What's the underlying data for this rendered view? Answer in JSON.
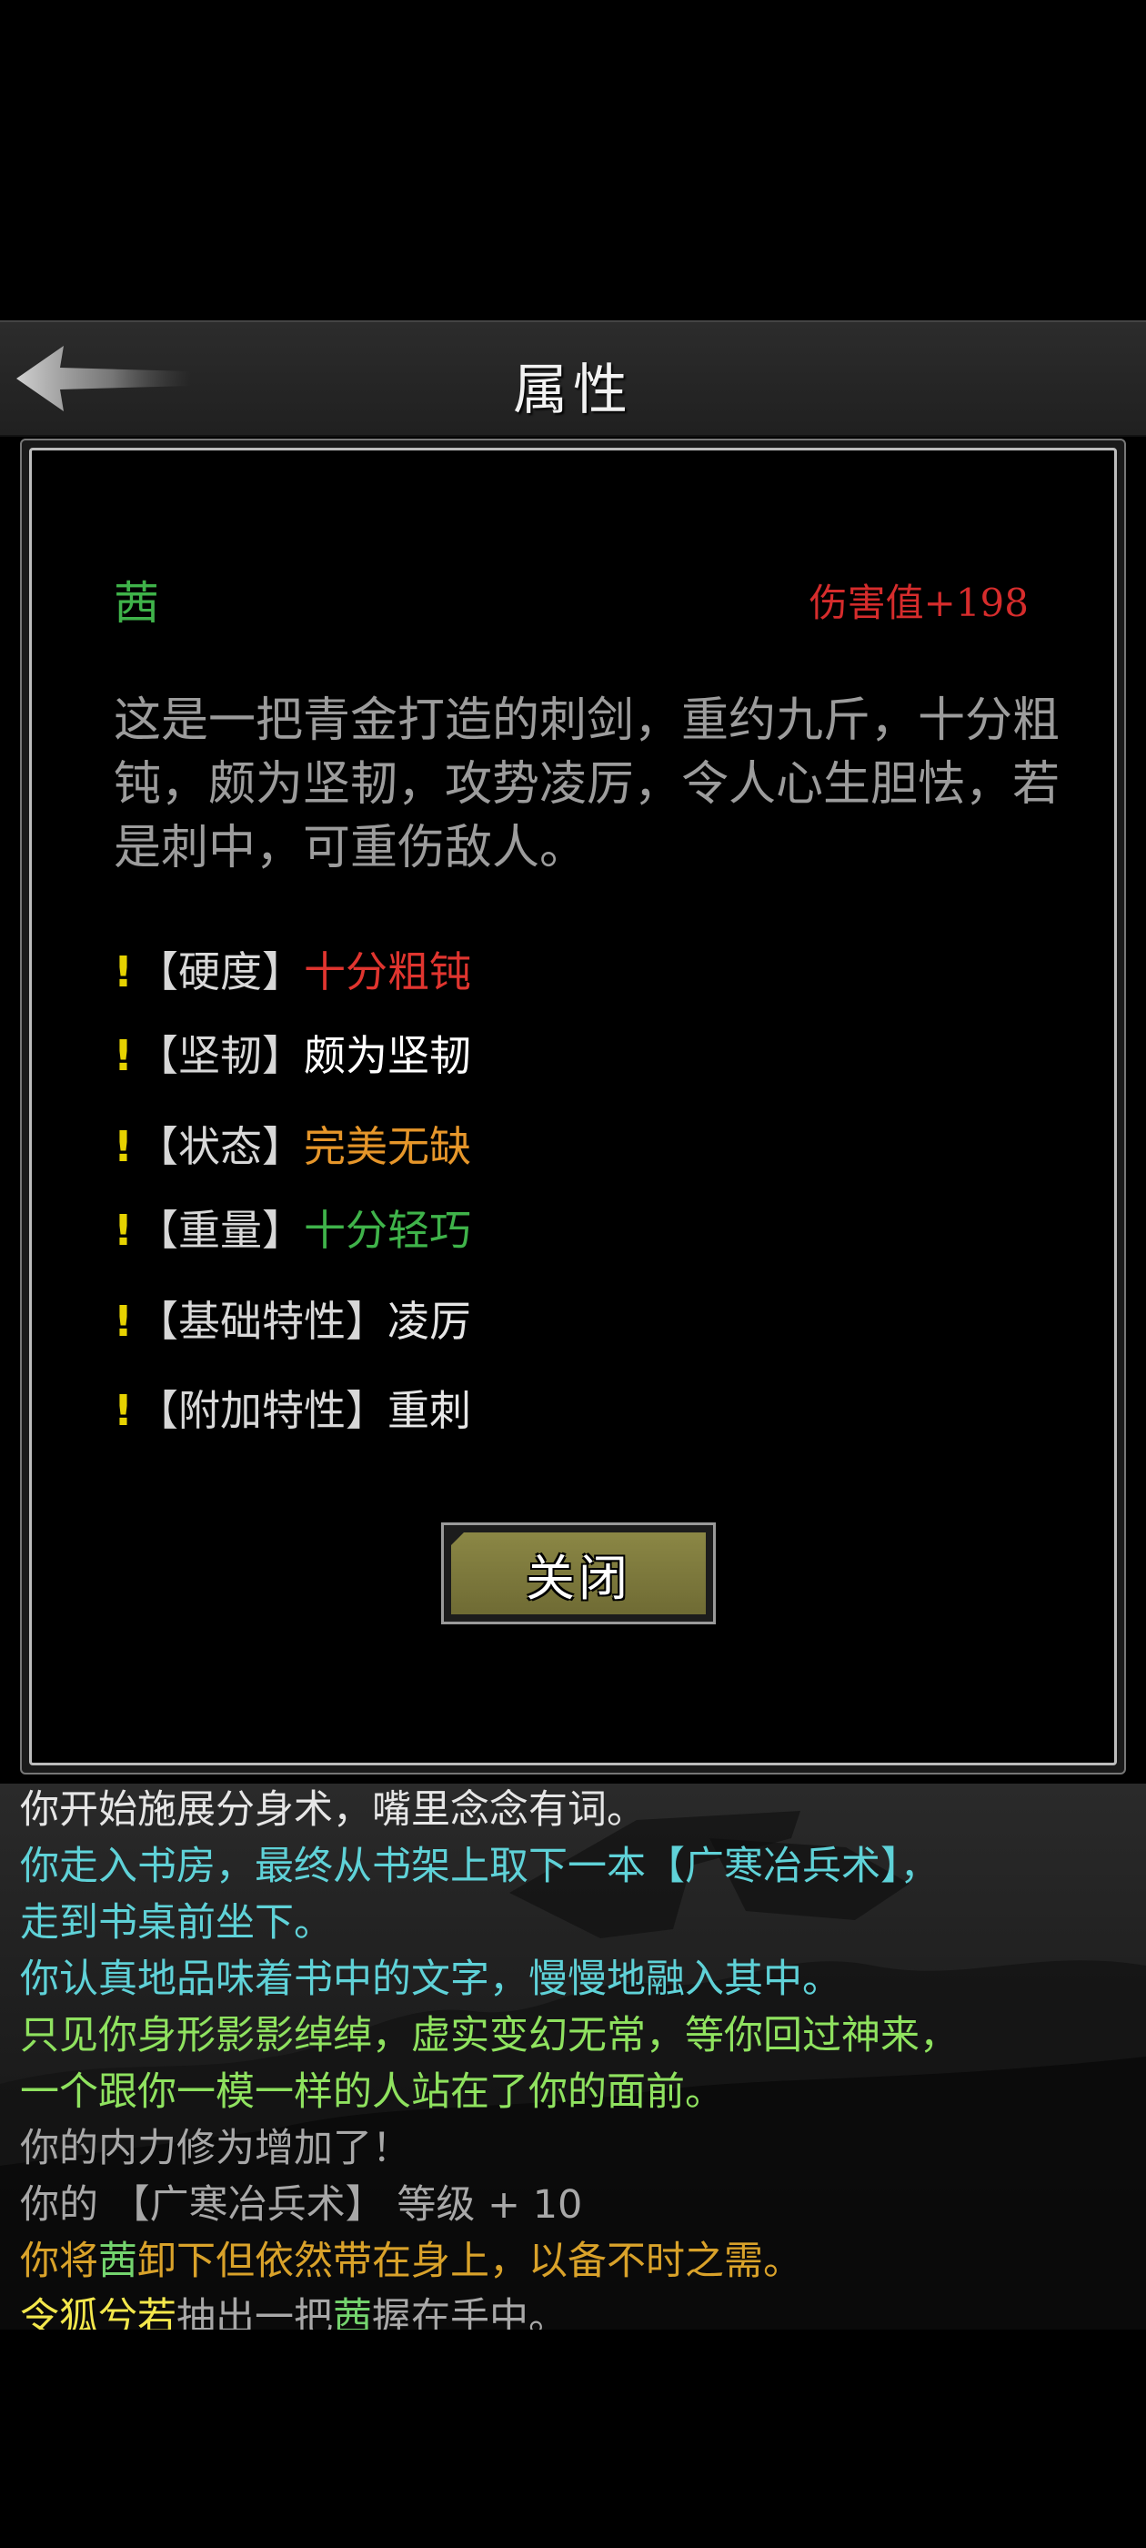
{
  "header": {
    "title": "属性"
  },
  "item": {
    "name": "茜",
    "damage": "伤害值+198",
    "description": "这是一把青金打造的刺剑，重约九斤，十分粗钝，颇为坚韧，攻势凌厉，令人心生胆怯，若是刺中，可重伤敌人。",
    "attributes": [
      {
        "mark": "!",
        "key": "【硬度】",
        "value": "十分粗钝",
        "color": "#e0352f"
      },
      {
        "mark": "!",
        "key": "【坚韧】",
        "value": "颇为坚韧",
        "color": "#ffffff"
      },
      {
        "mark": "!",
        "key": "【状态】",
        "value": "完美无缺",
        "color": "#e6962a"
      },
      {
        "mark": "!",
        "key": "【重量】",
        "value": "十分轻巧",
        "color": "#3fb34a"
      },
      {
        "mark": "!",
        "key": "【基础特性】",
        "value": "凌厉",
        "color": "#e6e6e6"
      },
      {
        "mark": "!",
        "key": "【附加特性】",
        "value": "重刺",
        "color": "#e6e6e6"
      }
    ],
    "close_label": "关闭"
  },
  "log": {
    "line1": "你开始施展分身术，嘴里念念有词。",
    "line2": "你走入书房，最终从书架上取下一本【广寒冶兵术】，",
    "line3": "走到书桌前坐下。",
    "line4": "你认真地品味着书中的文字，慢慢地融入其中。",
    "line5": "只见你身形影影绰绰，虚实变幻无常，等你回过神来，",
    "line6": "一个跟你一模一样的人站在了你的面前。",
    "line7": "你的内力修为增加了！",
    "line8": "你的 【广寒冶兵术】 等级 + 10",
    "line9_a": "你将",
    "line9_b": "茜",
    "line9_c": "卸下但依然带在身上，以备不时之需。",
    "line10_a": "令狐兮若",
    "line10_b": "抽出一把",
    "line10_c": "茜",
    "line10_d": "握在手中。"
  }
}
